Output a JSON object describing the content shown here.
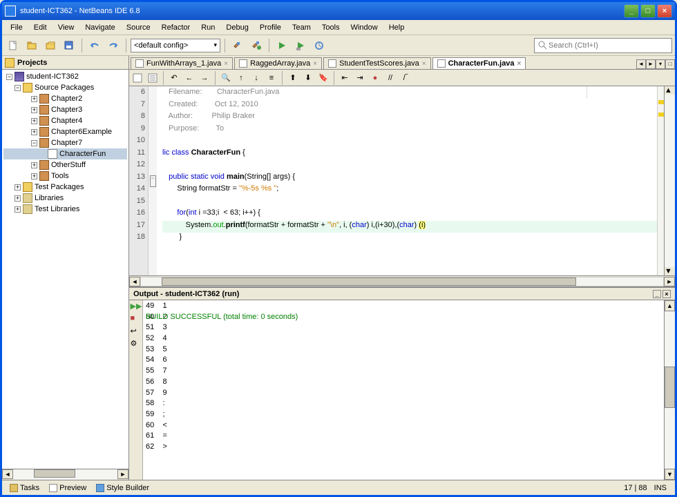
{
  "window": {
    "title": "student-ICT362 - NetBeans IDE 6.8"
  },
  "menu": {
    "file": "File",
    "edit": "Edit",
    "view": "View",
    "navigate": "Navigate",
    "source": "Source",
    "refactor": "Refactor",
    "run": "Run",
    "debug": "Debug",
    "profile": "Profile",
    "team": "Team",
    "tools": "Tools",
    "window": "Window",
    "help": "Help"
  },
  "toolbar": {
    "config": "<default config>",
    "search_placeholder": "Search (Ctrl+I)"
  },
  "projects": {
    "title": "Projects",
    "root": "student-ICT362",
    "src": "Source Packages",
    "chapters": [
      "Chapter2",
      "Chapter3",
      "Chapter4",
      "Chapter6Example",
      "Chapter7"
    ],
    "file": "CharacterFun",
    "other": "OtherStuff",
    "tools": "Tools",
    "testpkg": "Test Packages",
    "libs": "Libraries",
    "testlibs": "Test Libraries"
  },
  "tabs": {
    "t1": "FunWithArrays_1.java",
    "t2": "RaggedArray.java",
    "t3": "StudentTestScores.java",
    "t4": "CharacterFun.java"
  },
  "code": {
    "l6": "   Filename:       CharacterFun.java",
    "l7": "   Created:        Oct 12, 2010",
    "l8": "   Author:         Philip Braker",
    "l9": "   Purpose:        To",
    "l10": "",
    "l11a": "lic class ",
    "l11b": "CharacterFun",
    "l11c": " {",
    "l12": "",
    "l13a": "   ",
    "l13b": "public static ",
    "l13c": "void",
    "l13d": " ",
    "l13e": "main",
    "l13f": "(String[] args) {",
    "l14a": "       String formatStr = ",
    "l14b": "\"%-5s %s \"",
    "l14c": ";",
    "l15": "",
    "l16a": "       ",
    "l16b": "for",
    "l16c": "(",
    "l16d": "int",
    "l16e": " i =33;i  < 63; i++) {",
    "l17a": "           System.",
    "l17b": "out",
    "l17c": ".",
    "l17d": "printf",
    "l17e": "(formatStr + formatStr + ",
    "l17f": "\"\\n\"",
    "l17g": ", i, (",
    "l17h": "char",
    "l17i": ") i,(i+30),(",
    "l17j": "char",
    "l17k": ") ",
    "l17l": "(i)",
    "l18": "        }",
    "gutter": [
      "6",
      "7",
      "8",
      "9",
      "10",
      "11",
      "12",
      "13",
      "14",
      "15",
      "16",
      "17",
      "18"
    ]
  },
  "output": {
    "title": "Output - student-ICT362 (run)",
    "rows": [
      [
        "49",
        "1"
      ],
      [
        "50",
        "2"
      ],
      [
        "51",
        "3"
      ],
      [
        "52",
        "4"
      ],
      [
        "53",
        "5"
      ],
      [
        "54",
        "6"
      ],
      [
        "55",
        "7"
      ],
      [
        "56",
        "8"
      ],
      [
        "57",
        "9"
      ],
      [
        "58",
        ":"
      ],
      [
        "59",
        ";"
      ],
      [
        "60",
        "<"
      ],
      [
        "61",
        "="
      ],
      [
        "62",
        ">"
      ]
    ],
    "build": "BUILD SUCCESSFUL (total time: 0 seconds)"
  },
  "status": {
    "tasks": "Tasks",
    "preview": "Preview",
    "style": "Style Builder",
    "pos": "17 | 88",
    "ins": "INS"
  }
}
